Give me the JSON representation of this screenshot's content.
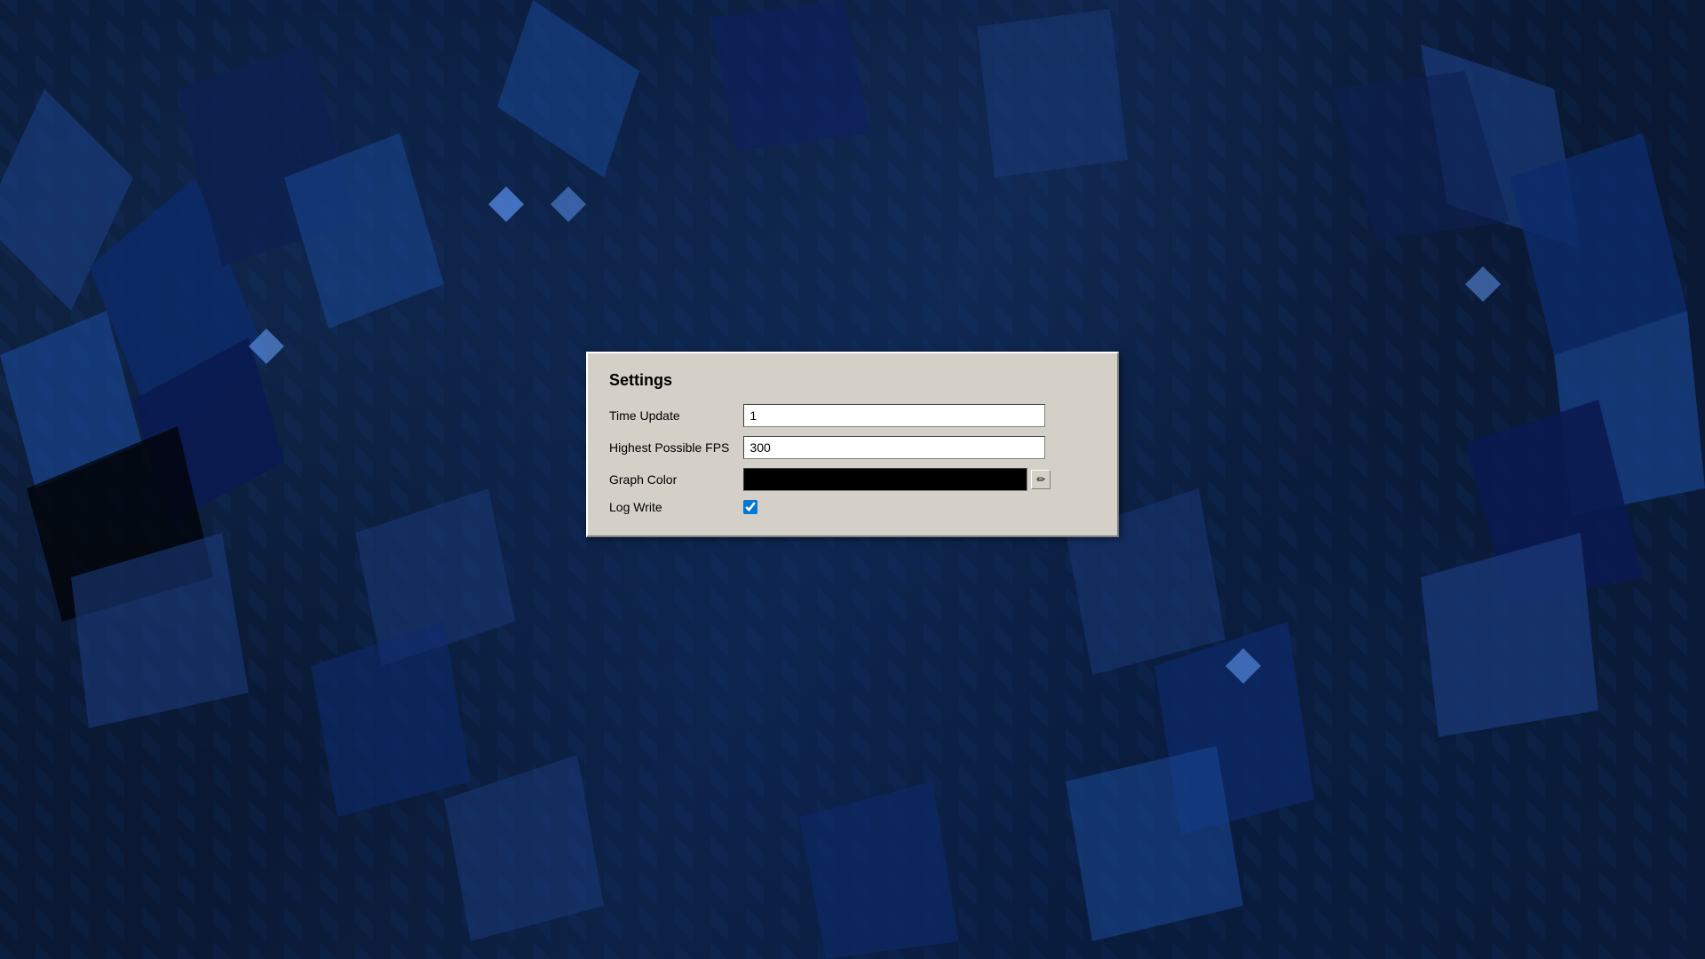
{
  "background": {
    "color": "#0a1830"
  },
  "dialog": {
    "title": "Settings",
    "fields": [
      {
        "id": "time-update",
        "label": "Time Update",
        "type": "text",
        "value": "1",
        "placeholder": ""
      },
      {
        "id": "highest-possible-fps",
        "label": "Highest Possible FPS",
        "type": "text",
        "value": "300",
        "placeholder": ""
      },
      {
        "id": "graph-color",
        "label": "Graph Color",
        "type": "color",
        "value": "#000000"
      },
      {
        "id": "log-write",
        "label": "Log Write",
        "type": "checkbox",
        "checked": true
      }
    ],
    "color_picker_icon": "✏"
  }
}
